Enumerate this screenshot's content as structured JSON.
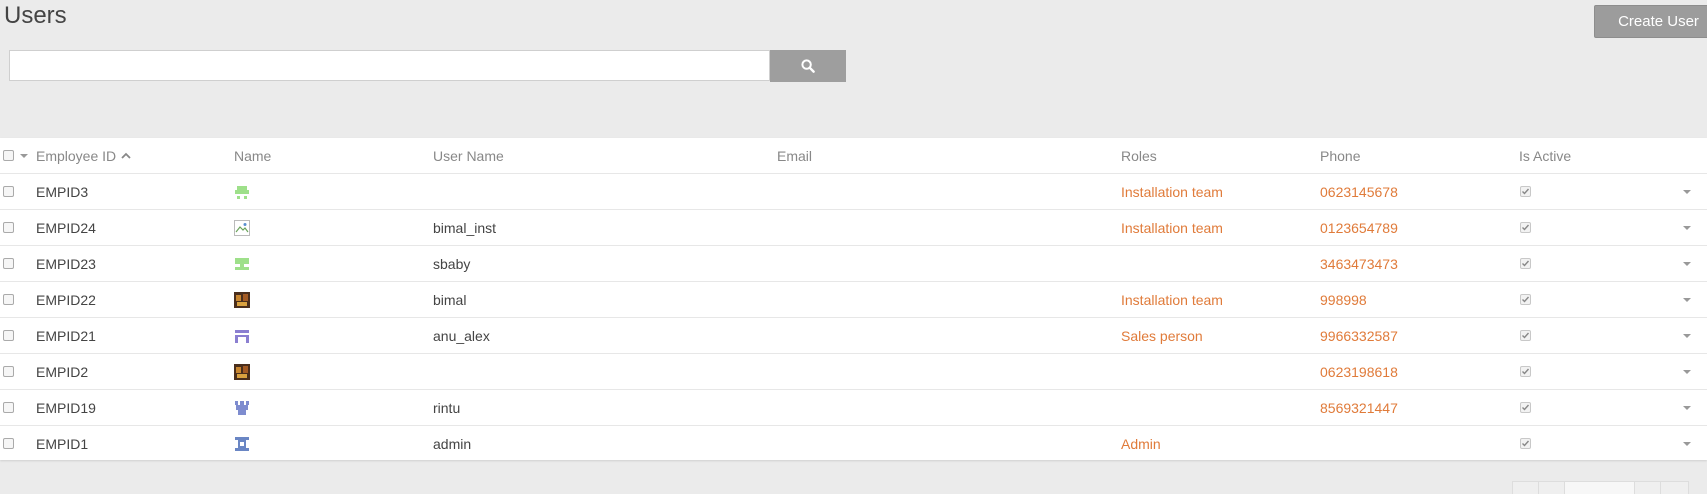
{
  "header": {
    "title": "Users",
    "create_button": "Create User"
  },
  "search": {
    "value": "",
    "placeholder": "",
    "icon": "search-icon"
  },
  "table": {
    "columns": {
      "employee_id": "Employee ID",
      "name": "Name",
      "user_name": "User Name",
      "email": "Email",
      "roles": "Roles",
      "phone": "Phone",
      "is_active": "Is Active"
    },
    "sort": {
      "column": "Employee ID",
      "direction": "ascending",
      "icon": "chevron-up-icon"
    },
    "rows": [
      {
        "employee_id": "EMPID3",
        "avatar": "green-identicon",
        "user_name": "",
        "role": "Installation team",
        "phone": "0623145678",
        "is_active": true
      },
      {
        "employee_id": "EMPID24",
        "avatar": "broken-image",
        "user_name": "bimal_inst",
        "role": "Installation team",
        "phone": "0123654789",
        "is_active": true
      },
      {
        "employee_id": "EMPID23",
        "avatar": "green-identicon",
        "user_name": "sbaby",
        "role": "",
        "phone": "3463473473",
        "is_active": true
      },
      {
        "employee_id": "EMPID22",
        "avatar": "photo",
        "user_name": "bimal",
        "role": "Installation team",
        "phone": "998998",
        "is_active": true
      },
      {
        "employee_id": "EMPID21",
        "avatar": "purple-identicon",
        "user_name": "anu_alex",
        "role": "Sales person",
        "phone": "9966332587",
        "is_active": true
      },
      {
        "employee_id": "EMPID2",
        "avatar": "photo",
        "user_name": "",
        "role": "",
        "phone": "0623198618",
        "is_active": true
      },
      {
        "employee_id": "EMPID19",
        "avatar": "blue-identicon",
        "user_name": "rintu",
        "role": "",
        "phone": "8569321447",
        "is_active": true
      },
      {
        "employee_id": "EMPID1",
        "avatar": "blue-identicon",
        "user_name": "admin",
        "role": "Admin",
        "phone": "",
        "is_active": true
      }
    ]
  },
  "colors": {
    "accent": "#e07b3a",
    "button_gray": "#9c9c9c",
    "page_bg": "#ebebeb"
  }
}
